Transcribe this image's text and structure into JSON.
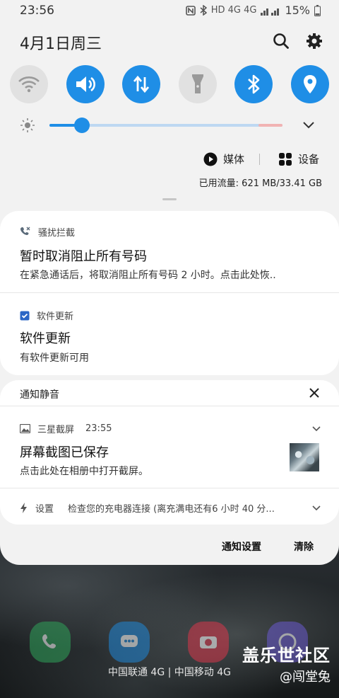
{
  "status_bar": {
    "time": "23:56",
    "network_icons": "HD 4G 4G",
    "battery": "15%"
  },
  "header": {
    "date": "4月1日周三"
  },
  "quick_settings": [
    {
      "icon": "wifi-icon",
      "on": false
    },
    {
      "icon": "sound-icon",
      "on": true
    },
    {
      "icon": "mobile-data-icon",
      "on": true
    },
    {
      "icon": "flashlight-icon",
      "on": false
    },
    {
      "icon": "bluetooth-icon",
      "on": true
    },
    {
      "icon": "location-icon",
      "on": true
    }
  ],
  "brightness": {
    "level": 0.14
  },
  "media": {
    "media_label": "媒体",
    "devices_label": "设备"
  },
  "data_usage": "已用流量: 621 MB/33.41 GB",
  "notifications": {
    "call_block": {
      "app": "骚扰拦截",
      "title": "暂时取消阻止所有号码",
      "body": "在紧急通话后，将取消阻止所有号码 2 小时。点击此处恢.."
    },
    "software_update": {
      "app": "软件更新",
      "title": "软件更新",
      "body": "有软件更新可用"
    },
    "silent_header": "通知静音",
    "screenshot": {
      "app": "三星截屏",
      "time": "23:55",
      "title": "屏幕截图已保存",
      "body": "点击此处在相册中打开截屏。"
    },
    "charging": {
      "app": "设置",
      "body": "检查您的充电器连接 (离充满电还有6 小时 40 分..."
    }
  },
  "footer": {
    "settings_label": "通知设置",
    "clear_label": "清除"
  },
  "carrier_text": "中国联通 4G | 中国移动 4G",
  "watermark": {
    "line1": "盖乐世社区",
    "line2": "@闯堂兔"
  },
  "colors": {
    "accent": "#1f8ee6",
    "panel": "#f2f2f2"
  }
}
